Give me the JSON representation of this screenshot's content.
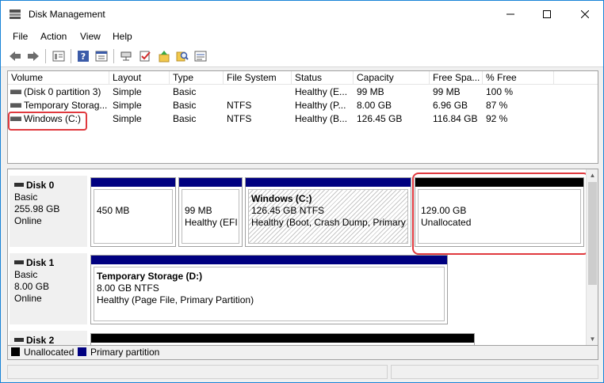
{
  "window": {
    "title": "Disk Management",
    "accent": "#1883d7",
    "highlight_color": "#e0393e"
  },
  "menu": [
    "File",
    "Action",
    "View",
    "Help"
  ],
  "toolbar_icons": [
    "back-arrow-icon",
    "forward-arrow-icon",
    "disk-list-icon",
    "help-icon",
    "properties-icon",
    "connect-icon",
    "check-icon",
    "folder-up-icon",
    "search-icon",
    "rescan-icon"
  ],
  "volumes": {
    "columns": [
      "Volume",
      "Layout",
      "Type",
      "File System",
      "Status",
      "Capacity",
      "Free Spa...",
      "% Free"
    ],
    "rows": [
      [
        "(Disk 0 partition 3)",
        "Simple",
        "Basic",
        "",
        "Healthy (E...",
        "99 MB",
        "99 MB",
        "100 %"
      ],
      [
        "Temporary Storag...",
        "Simple",
        "Basic",
        "NTFS",
        "Healthy (P...",
        "8.00 GB",
        "6.96 GB",
        "87 %"
      ],
      [
        "Windows (C:)",
        "Simple",
        "Basic",
        "NTFS",
        "Healthy (B...",
        "126.45 GB",
        "116.84 GB",
        "92 %"
      ]
    ]
  },
  "disks": [
    {
      "name": "Disk 0",
      "type": "Basic",
      "size": "255.98 GB",
      "status": "Online",
      "partitions": [
        {
          "line1": "",
          "line2": "450 MB",
          "line3": ""
        },
        {
          "line1": "",
          "line2": "99 MB",
          "line3": "Healthy (EFI"
        },
        {
          "line1": "Windows  (C:)",
          "line2": "126.45 GB NTFS",
          "line3": "Healthy (Boot, Crash Dump, Primary P"
        },
        {
          "line1": "",
          "line2": "129.00 GB",
          "line3": "Unallocated"
        }
      ]
    },
    {
      "name": "Disk 1",
      "type": "Basic",
      "size": "8.00 GB",
      "status": "Online",
      "partitions": [
        {
          "line1": "Temporary Storage  (D:)",
          "line2": "8.00 GB NTFS",
          "line3": "Healthy (Page File, Primary Partition)"
        }
      ]
    },
    {
      "name": "Disk 2"
    }
  ],
  "legend": [
    {
      "label": "Unallocated",
      "color": "#000000"
    },
    {
      "label": "Primary partition",
      "color": "#000080"
    }
  ]
}
